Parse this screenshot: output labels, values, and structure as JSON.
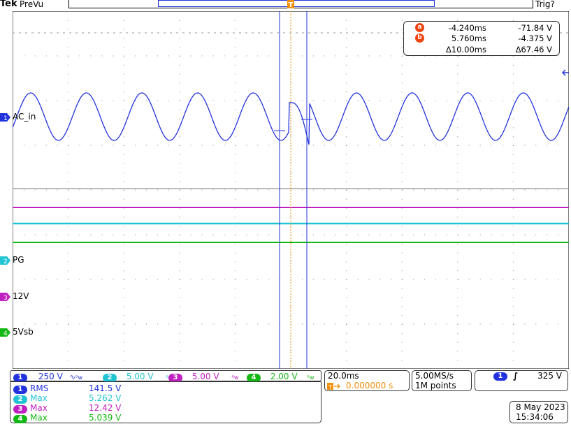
{
  "header": {
    "brand": "Tek",
    "mode": "PreVu",
    "trigger_status": "Trig?"
  },
  "colors": {
    "ch1": "#2233dd",
    "ch2": "#22c4d4",
    "ch3": "#c020c0",
    "ch4": "#14b814",
    "cursor_tag": "#ee4411",
    "trigger_marker": "#f09010"
  },
  "waveforms": {
    "ch1": {
      "label": "AC_in",
      "shape": "sine"
    },
    "ch2": {
      "label": "PG"
    },
    "ch3": {
      "label": "12V"
    },
    "ch4": {
      "label": "5Vsb"
    }
  },
  "cursors": {
    "a": {
      "tag": "a",
      "time": "-4.240ms",
      "voltage": "-71.84 V"
    },
    "b": {
      "tag": "b",
      "time": "5.760ms",
      "voltage": "-4.375 V"
    },
    "delta": {
      "time": "Δ10.00ms",
      "voltage": "Δ67.46 V"
    }
  },
  "channel_scales": [
    {
      "num": "1",
      "value": "250 V",
      "coupling": "∿",
      "bw": "ᴮw",
      "color": "#2233dd"
    },
    {
      "num": "2",
      "value": "5.00 V",
      "bw": "ᴮw",
      "color": "#22c4d4"
    },
    {
      "num": "3",
      "value": "5.00 V",
      "bw": "ᴮw",
      "color": "#c020c0"
    },
    {
      "num": "4",
      "value": "2.00 V",
      "bw": "ᴮw",
      "color": "#14b814"
    }
  ],
  "timebase": {
    "scale": "20.0ms",
    "position": "0.000000 s"
  },
  "acquisition": {
    "rate": "5.00MS/s",
    "record": "1M points"
  },
  "trigger": {
    "channel": "1",
    "slope": "∫",
    "level": "325 V"
  },
  "measurements": [
    {
      "ch": "1",
      "name": "RMS",
      "value": "141.5 V"
    },
    {
      "ch": "2",
      "name": "Max",
      "value": "5.262 V"
    },
    {
      "ch": "3",
      "name": "Max",
      "value": "12.42 V"
    },
    {
      "ch": "4",
      "name": "Max",
      "value": "5.039 V"
    }
  ],
  "datetime": {
    "date": "8 May 2023",
    "time": "15:34:06"
  }
}
